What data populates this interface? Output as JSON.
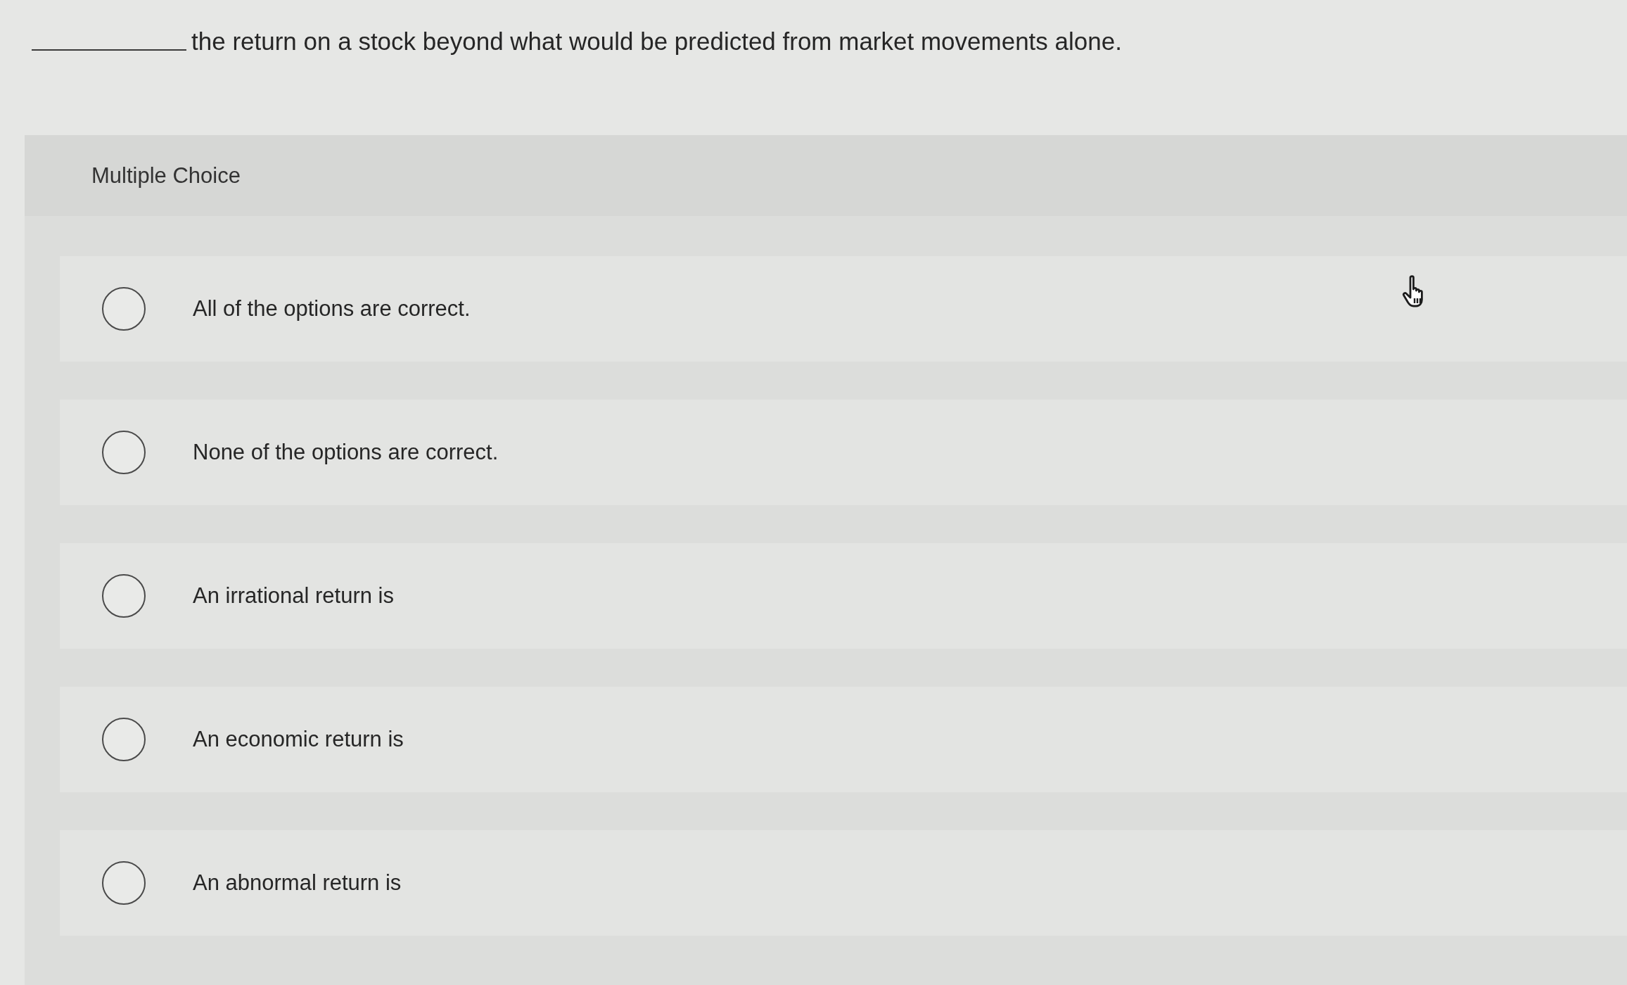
{
  "question": {
    "text": "the return on a stock beyond what would be predicted from market movements alone."
  },
  "answer_panel": {
    "heading": "Multiple Choice",
    "options": [
      {
        "label": "All of the options are correct.",
        "selected": false
      },
      {
        "label": "None of the options are correct.",
        "selected": false
      },
      {
        "label": "An irrational return is",
        "selected": false
      },
      {
        "label": "An economic return is",
        "selected": false
      },
      {
        "label": "An abnormal return is",
        "selected": false
      }
    ]
  }
}
